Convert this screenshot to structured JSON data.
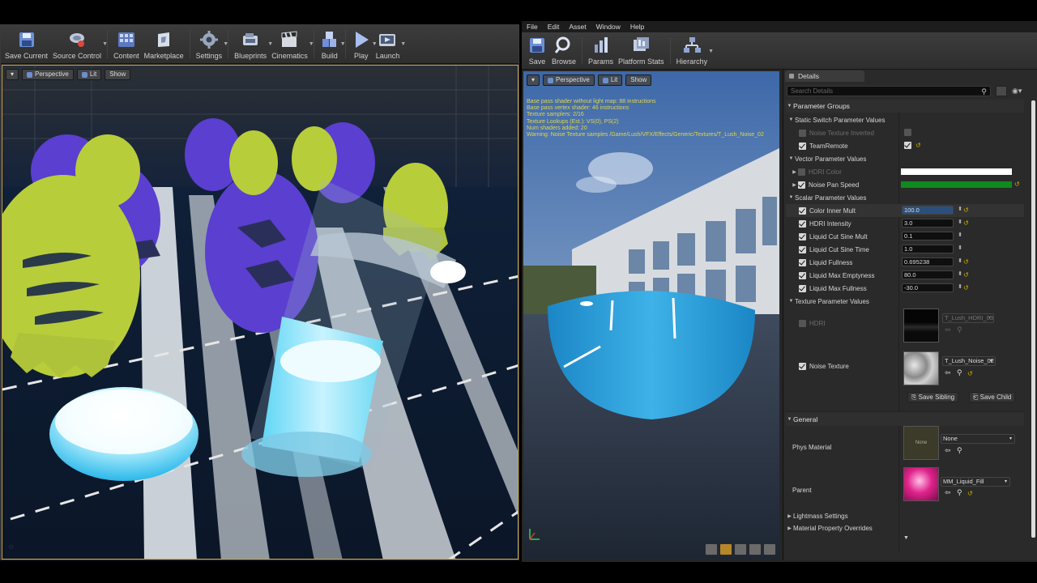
{
  "left_editor": {
    "toolbar": [
      {
        "label": "Save Current",
        "icon": "save-icon",
        "dropdown": false
      },
      {
        "label": "Source Control",
        "icon": "source-control-icon",
        "dropdown": true
      },
      {
        "label": "Content",
        "icon": "content-icon",
        "dropdown": false
      },
      {
        "label": "Marketplace",
        "icon": "marketplace-icon",
        "dropdown": false
      },
      {
        "label": "Settings",
        "icon": "settings-icon",
        "dropdown": true
      },
      {
        "label": "Blueprints",
        "icon": "blueprints-icon",
        "dropdown": true
      },
      {
        "label": "Cinematics",
        "icon": "cinematics-icon",
        "dropdown": true
      },
      {
        "label": "Build",
        "icon": "build-icon",
        "dropdown": true
      },
      {
        "label": "Play",
        "icon": "play-icon",
        "dropdown": true
      },
      {
        "label": "Launch",
        "icon": "launch-icon",
        "dropdown": true
      }
    ],
    "viewport": {
      "mode": "Perspective",
      "lighting": "Lit",
      "show": "Show"
    }
  },
  "right_editor": {
    "menu": [
      "File",
      "Edit",
      "Asset",
      "Window",
      "Help"
    ],
    "toolbar": [
      {
        "label": "Save",
        "icon": "save-icon"
      },
      {
        "label": "Browse",
        "icon": "browse-icon"
      },
      {
        "label": "Params",
        "icon": "params-icon"
      },
      {
        "label": "Platform Stats",
        "icon": "platform-stats-icon"
      },
      {
        "label": "Hierarchy",
        "icon": "hierarchy-icon"
      }
    ],
    "viewport": {
      "mode": "Perspective",
      "lighting": "Lit",
      "show": "Show",
      "stats": [
        "Base pass shader without light map: 88 instructions",
        "Base pass vertex shader: 46 instructions",
        "Texture samplers: 2/16",
        "Texture Lookups (Est.): VS(0), PS(2)",
        "Num shaders added: 20",
        "Warning: Noise Texture samples /Game/Lush/VFX/Effects/Generic/Textures/T_Lush_Noise_02"
      ]
    },
    "details": {
      "tab": "Details",
      "search_placeholder": "Search Details",
      "parameter_groups": "Parameter Groups",
      "static_switch": {
        "title": "Static Switch Parameter Values",
        "items": [
          {
            "name": "Noise Texture Inverted",
            "enabled": false,
            "value": false
          },
          {
            "name": "TeamRemote",
            "enabled": true,
            "value": true
          }
        ]
      },
      "vector": {
        "title": "Vector Parameter Values",
        "items": [
          {
            "name": "HDRI Color",
            "enabled": false,
            "color": "#ffffff"
          },
          {
            "name": "Noise Pan Speed",
            "enabled": true,
            "color": "#0e8a1e"
          }
        ]
      },
      "scalar": {
        "title": "Scalar Parameter Values",
        "items": [
          {
            "name": "Color Inner Mult",
            "value": "100.0"
          },
          {
            "name": "HDRI Intensity",
            "value": "3.0"
          },
          {
            "name": "Liquid Cut Sine Mult",
            "value": "0.1"
          },
          {
            "name": "Liquid Cut Sine Time",
            "value": "1.0"
          },
          {
            "name": "Liquid Fullness",
            "value": "0.695238"
          },
          {
            "name": "Liquid Max Emptyness",
            "value": "80.0"
          },
          {
            "name": "Liquid Max Fullness",
            "value": "-30.0"
          }
        ]
      },
      "texture": {
        "title": "Texture Parameter Values",
        "items": [
          {
            "name": "HDRI",
            "asset": "T_Lush_HDRI_03",
            "enabled": false
          },
          {
            "name": "Noise Texture",
            "asset": "T_Lush_Noise_02",
            "enabled": true
          }
        ],
        "save_sibling": "Save Sibling",
        "save_child": "Save Child"
      },
      "general": {
        "title": "General",
        "phys_material": {
          "label": "Phys Material",
          "value": "None",
          "thumb_text": "None"
        },
        "parent": {
          "label": "Parent",
          "value": "MM_Liquid_Fill"
        }
      },
      "collapsed": [
        "Lightmass Settings",
        "Material Property Overrides"
      ]
    }
  }
}
